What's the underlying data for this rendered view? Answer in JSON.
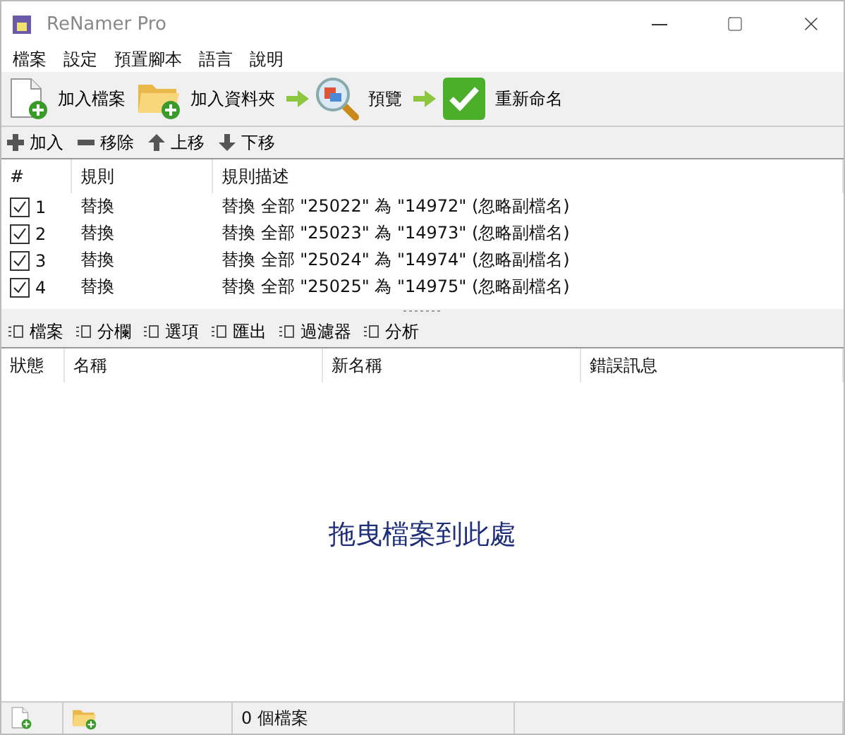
{
  "window": {
    "title": "ReNamer Pro"
  },
  "menu": [
    "檔案",
    "設定",
    "預置腳本",
    "語言",
    "說明"
  ],
  "toolbar": [
    "加入檔案",
    "加入資料夾",
    "預覽",
    "重新命名"
  ],
  "rules_toolbar": [
    "加入",
    "移除",
    "上移",
    "下移"
  ],
  "rules_table": {
    "columns": [
      "#",
      "規則",
      "規則描述"
    ],
    "rows": [
      {
        "checked": true,
        "number": "1",
        "rule": "替換",
        "description": "替換 全部 \"25022\" 為 \"14972\" (忽略副檔名)"
      },
      {
        "checked": true,
        "number": "2",
        "rule": "替換",
        "description": "替換 全部 \"25023\" 為 \"14973\" (忽略副檔名)"
      },
      {
        "checked": true,
        "number": "3",
        "rule": "替換",
        "description": "替換 全部 \"25024\" 為 \"14974\" (忽略副檔名)"
      },
      {
        "checked": true,
        "number": "4",
        "rule": "替換",
        "description": "替換 全部 \"25025\" 為 \"14975\" (忽略副檔名)"
      }
    ]
  },
  "files_toolbar": [
    "檔案",
    "分欄",
    "選項",
    "匯出",
    "過濾器",
    "分析"
  ],
  "files_table": {
    "columns": [
      "狀態",
      "名稱",
      "新名稱",
      "錯誤訊息"
    ],
    "empty_message": "拖曳檔案到此處"
  },
  "status_bar": {
    "file_count": "0 個檔案"
  }
}
